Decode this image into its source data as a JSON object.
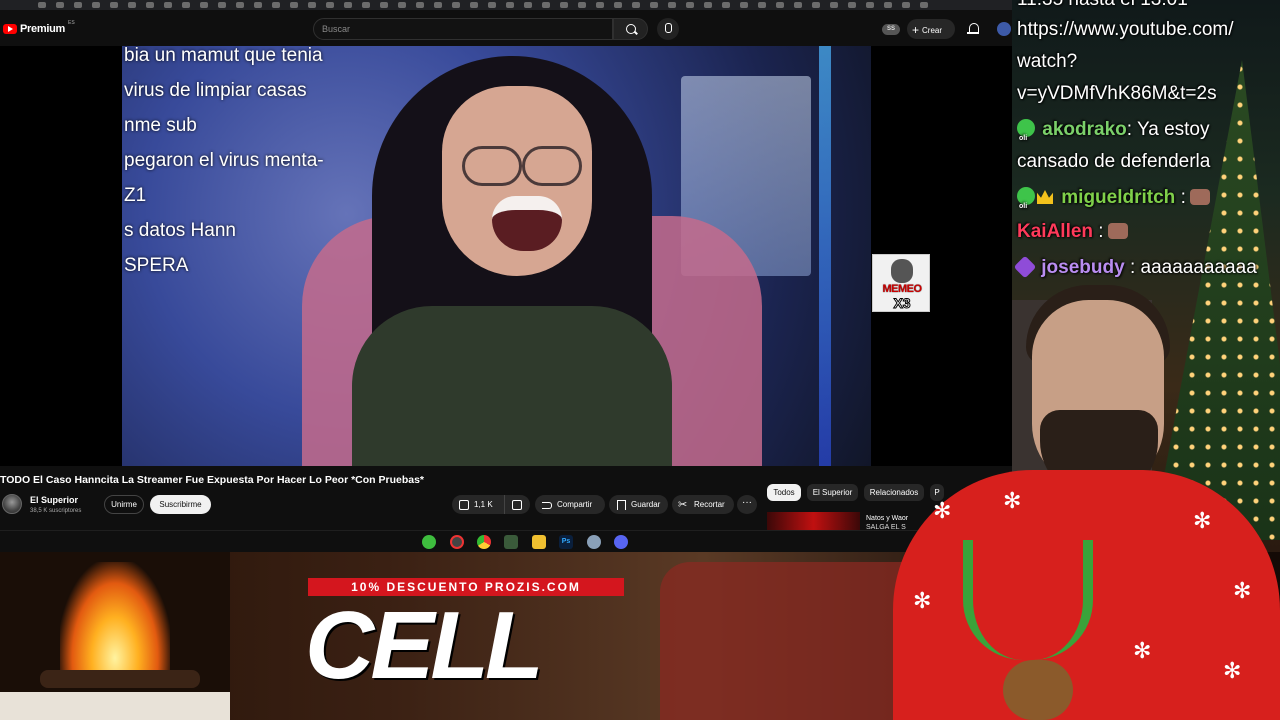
{
  "youtube": {
    "brand": "Premium",
    "region": "ES",
    "search_placeholder": "Buscar",
    "ss_badge": "SS",
    "create_label": "Crear",
    "video_title": "TODO El Caso Hanncita La Streamer Fue Expuesta Por Hacer Lo Peor *Con Pruebas*",
    "channel_name": "El Superior",
    "channel_subs": "38,5 K suscriptores",
    "join_label": "Unirme",
    "subscribe_label": "Suscribirme",
    "like_count": "1,1 K",
    "share_label": "Compartir",
    "save_label": "Guardar",
    "clip_label": "Recortar",
    "more_label": "···",
    "chips": [
      "Todos",
      "El Superior",
      "Relacionados",
      "P"
    ],
    "rec_title_1": "Natos y Waor",
    "rec_title_2": "SALGA EL S"
  },
  "video_overlay": {
    "chat_lines": [
      "bia un mamut que tenia",
      "virus de limpiar casas",
      "nme sub",
      "pegaron el virus menta-",
      "Z1",
      "s datos Hann",
      "SPERA"
    ],
    "badge_top": "MEMEO",
    "badge_bottom": "X3"
  },
  "twitch_chat": {
    "top_clipped": "11:35 hasta el 13:01",
    "url_line_1": "https://www.youtube.com/",
    "url_line_2": "watch?",
    "url_line_3": "v=yVDMfVhK86M&t=2s",
    "messages": [
      {
        "user": "akodrako",
        "user_color": "#7bd06a",
        "text_1": ": Ya estoy",
        "text_2": "cansado de defenderla"
      },
      {
        "user": "migueldritch",
        "user_color": "#7fd04a",
        "text_1": " :"
      },
      {
        "user": "KaiAllen",
        "user_color": "#ff3a5a",
        "text_1": " :"
      },
      {
        "user": "josebudy",
        "user_color": "#b98df0",
        "text_1": " : aaaaaaaaaaa"
      }
    ]
  },
  "banner": {
    "promo_strip": "10% DESCUENTO PROZIS.COM",
    "promo_big": "CELL"
  },
  "colors": {
    "yt_bg": "#0f0f0f",
    "accent_red": "#d4161e",
    "sweater_red": "#d7201d"
  }
}
